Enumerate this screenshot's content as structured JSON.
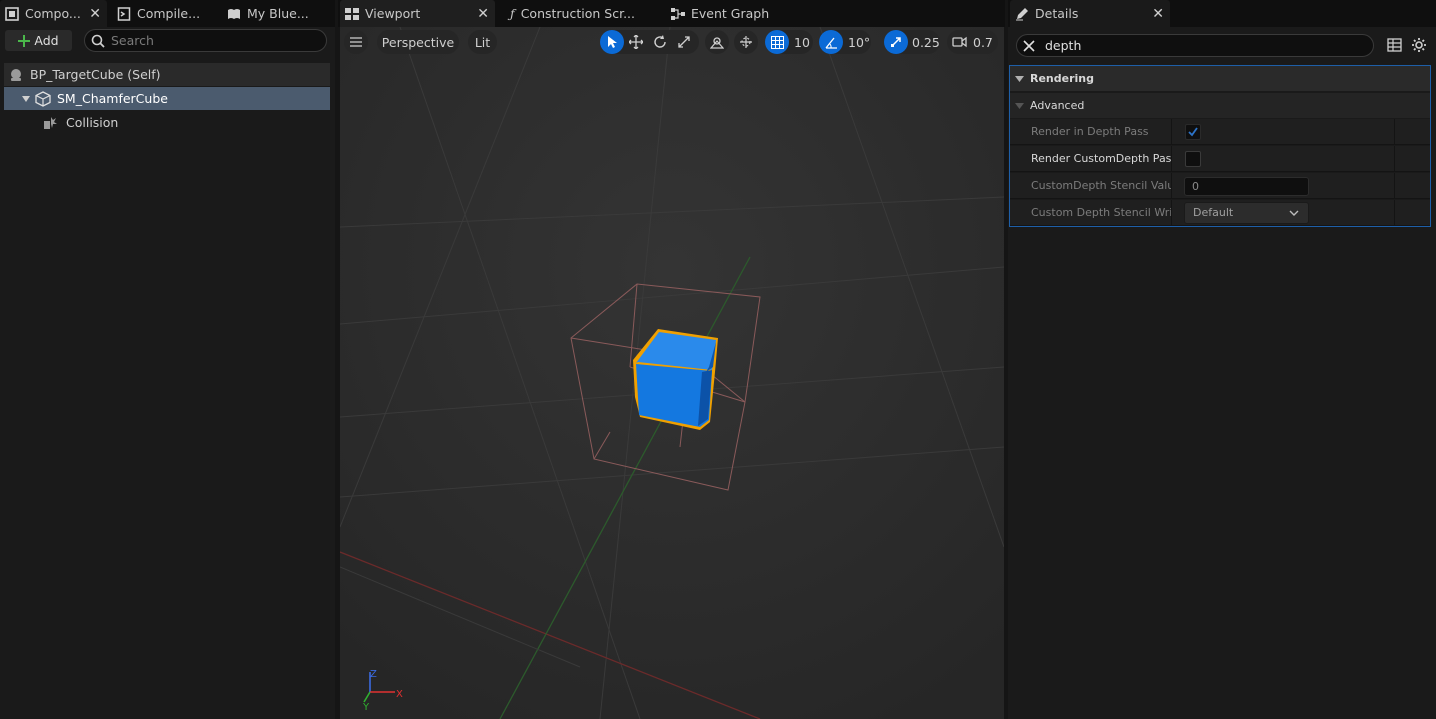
{
  "left_panel": {
    "tabs": [
      {
        "label": "Compo...",
        "icon": "components-icon",
        "closable": true,
        "active": true
      },
      {
        "label": "Compile...",
        "icon": "compile-icon",
        "closable": false
      },
      {
        "label": "My Blue...",
        "icon": "book-icon",
        "closable": false
      }
    ],
    "add_label": "Add",
    "search_placeholder": "Search",
    "tree": [
      {
        "label": "BP_TargetCube (Self)",
        "icon": "actor-icon"
      },
      {
        "label": "SM_ChamferCube",
        "icon": "static-mesh-icon",
        "selected": true,
        "expanded": true
      },
      {
        "label": "Collision",
        "icon": "collision-icon"
      }
    ]
  },
  "center_tabs": [
    {
      "label": "Viewport",
      "icon": "viewport-icon",
      "active": true,
      "closable": true
    },
    {
      "label": "Construction Scr...",
      "icon": "function-icon"
    },
    {
      "label": "Event Graph",
      "icon": "graph-icon"
    }
  ],
  "viewport_toolbar": {
    "view_mode": "Perspective",
    "lighting": "Lit",
    "grid_snap": "10",
    "rotation_snap": "10°",
    "scale_snap": "0.25",
    "camera_speed": "0.7"
  },
  "axes": {
    "x": "X",
    "y": "Y",
    "z": "Z"
  },
  "details": {
    "tab_label": "Details",
    "search_value": "depth",
    "categories": [
      {
        "label": "Rendering"
      },
      {
        "label": "Advanced"
      }
    ],
    "properties": [
      {
        "label": "Render in Depth Pass",
        "type": "checkbox",
        "checked": true,
        "enabled": false
      },
      {
        "label": "Render CustomDepth Pass",
        "type": "checkbox",
        "checked": false,
        "enabled": true
      },
      {
        "label": "CustomDepth Stencil Value",
        "type": "number",
        "value": "0",
        "enabled": false
      },
      {
        "label": "Custom Depth Stencil Writ...",
        "type": "dropdown",
        "value": "Default",
        "enabled": false
      }
    ]
  },
  "colors": {
    "accent_blue": "#0b6ad6",
    "selection_orange": "#f0a000",
    "cube_blue": "#1478e0"
  }
}
